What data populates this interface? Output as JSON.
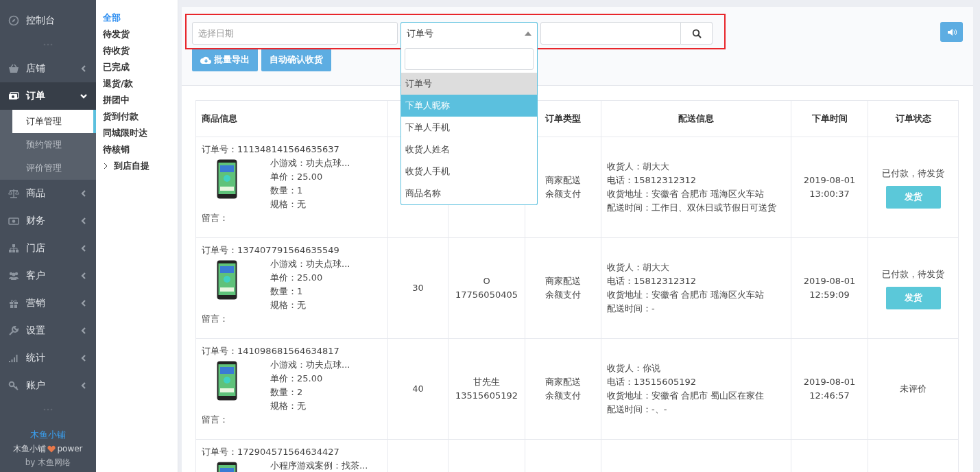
{
  "sidebar": {
    "items": [
      {
        "kind": "link",
        "label": "控制台",
        "selected": false
      },
      {
        "kind": "divider"
      },
      {
        "kind": "menu",
        "label": "店铺",
        "selected": false,
        "expanded": false
      },
      {
        "kind": "menu",
        "label": "订单",
        "selected": true,
        "expanded": true,
        "children": [
          {
            "label": "订单管理",
            "selected": true
          },
          {
            "label": "预约管理",
            "selected": false
          },
          {
            "label": "评价管理",
            "selected": false
          }
        ]
      },
      {
        "kind": "menu",
        "label": "商品",
        "selected": false,
        "expanded": false
      },
      {
        "kind": "menu",
        "label": "财务",
        "selected": false,
        "expanded": false
      },
      {
        "kind": "menu",
        "label": "门店",
        "selected": false,
        "expanded": false
      },
      {
        "kind": "menu",
        "label": "客户",
        "selected": false,
        "expanded": false
      },
      {
        "kind": "menu",
        "label": "营销",
        "selected": false,
        "expanded": false
      },
      {
        "kind": "menu",
        "label": "设置",
        "selected": false,
        "expanded": false
      },
      {
        "kind": "menu",
        "label": "统计",
        "selected": false,
        "expanded": false
      },
      {
        "kind": "menu",
        "label": "账户",
        "selected": false,
        "expanded": false
      },
      {
        "kind": "divider"
      }
    ],
    "footer": {
      "brand": "木鱼小铺",
      "power": [
        "木鱼小铺",
        "power"
      ],
      "by": "by 木鱼网络"
    }
  },
  "status_filters": [
    {
      "label": "全部",
      "selected": true
    },
    {
      "label": "待发货",
      "selected": false
    },
    {
      "label": "待收货",
      "selected": false
    },
    {
      "label": "已完成",
      "selected": false
    },
    {
      "label": "退货/款",
      "selected": false
    },
    {
      "label": "拼团中",
      "selected": false
    },
    {
      "label": "货到付款",
      "selected": false
    },
    {
      "label": "同城限时达",
      "selected": false
    },
    {
      "label": "待核销",
      "selected": false
    },
    {
      "label": "到店自提",
      "selected": false,
      "kind": "group",
      "expanded": false
    }
  ],
  "toolbar": {
    "date_field": {
      "placeholder": "选择日期"
    },
    "search_type": {
      "value": "订单号",
      "expanded": true,
      "options": [
        {
          "label": "订单号",
          "selected": true,
          "highlighted": false
        },
        {
          "label": "下单人昵称",
          "selected": false,
          "highlighted": true
        },
        {
          "label": "下单人手机",
          "selected": false,
          "highlighted": false
        },
        {
          "label": "收货人姓名",
          "selected": false,
          "highlighted": false
        },
        {
          "label": "收货人手机",
          "selected": false,
          "highlighted": false
        },
        {
          "label": "商品名称",
          "selected": false,
          "highlighted": false
        }
      ]
    },
    "buttons": [
      {
        "kind": "export",
        "label": "批量导出"
      },
      {
        "kind": "plain",
        "label": "自动确认收货"
      }
    ]
  },
  "table": {
    "columns": [
      {
        "label": "商品信息"
      },
      {},
      {},
      {
        "label": "订单类型"
      },
      {
        "label": "配送信息"
      },
      {
        "label": "下单时间"
      },
      {
        "label": "订单状态"
      }
    ],
    "rows": [
      {
        "order_no": "订单号：111348141564635637",
        "product": [
          "小游戏：功夫点球...",
          "单价：25.00",
          "数量：1",
          "规格：无"
        ],
        "note": "留言：",
        "order_type": [
          "商家配送",
          "余额支付"
        ],
        "delivery": [
          "收货人：胡大大",
          "电话：15812312312",
          "收货地址：安徽省 合肥市 瑶海区火车站",
          "配送时间：工作日、双休日或节假日可送货"
        ],
        "time": [
          "2019-08-01",
          "13:00:37"
        ],
        "status": "已付款，待发货",
        "action": "发货"
      },
      {
        "order_no": "订单号：137407791564635549",
        "product": [
          "小游戏：功夫点球...",
          "单价：25.00",
          "数量：1",
          "规格：无"
        ],
        "note": "留言：",
        "column_2": "30",
        "column_3": [
          "O",
          "17756050405"
        ],
        "order_type": [
          "商家配送",
          "余额支付"
        ],
        "delivery": [
          "收货人：胡大大",
          "电话：15812312312",
          "收货地址：安徽省 合肥市 瑶海区火车站",
          "配送时间：-"
        ],
        "time": [
          "2019-08-01",
          "12:59:09"
        ],
        "status": "已付款，待发货",
        "action": "发货"
      },
      {
        "order_no": "订单号：141098681564634817",
        "product": [
          "小游戏：功夫点球...",
          "单价：25.00",
          "数量：2",
          "规格：无"
        ],
        "note": "留言：",
        "column_2": "40",
        "column_3": [
          "甘先生",
          "13515605192"
        ],
        "order_type": [
          "商家配送",
          "余额支付"
        ],
        "delivery": [
          "收货人：你说",
          "电话：13515605192",
          "收货地址：安徽省 合肥市 蜀山区在家住",
          "配送时间：-、-"
        ],
        "time": [
          "2019-08-01",
          "12:46:57"
        ],
        "status": "未评价"
      },
      {
        "order_no": "订单号：172904571564634427",
        "product": [
          "小程序游戏案例：找茶..."
        ]
      }
    ]
  }
}
